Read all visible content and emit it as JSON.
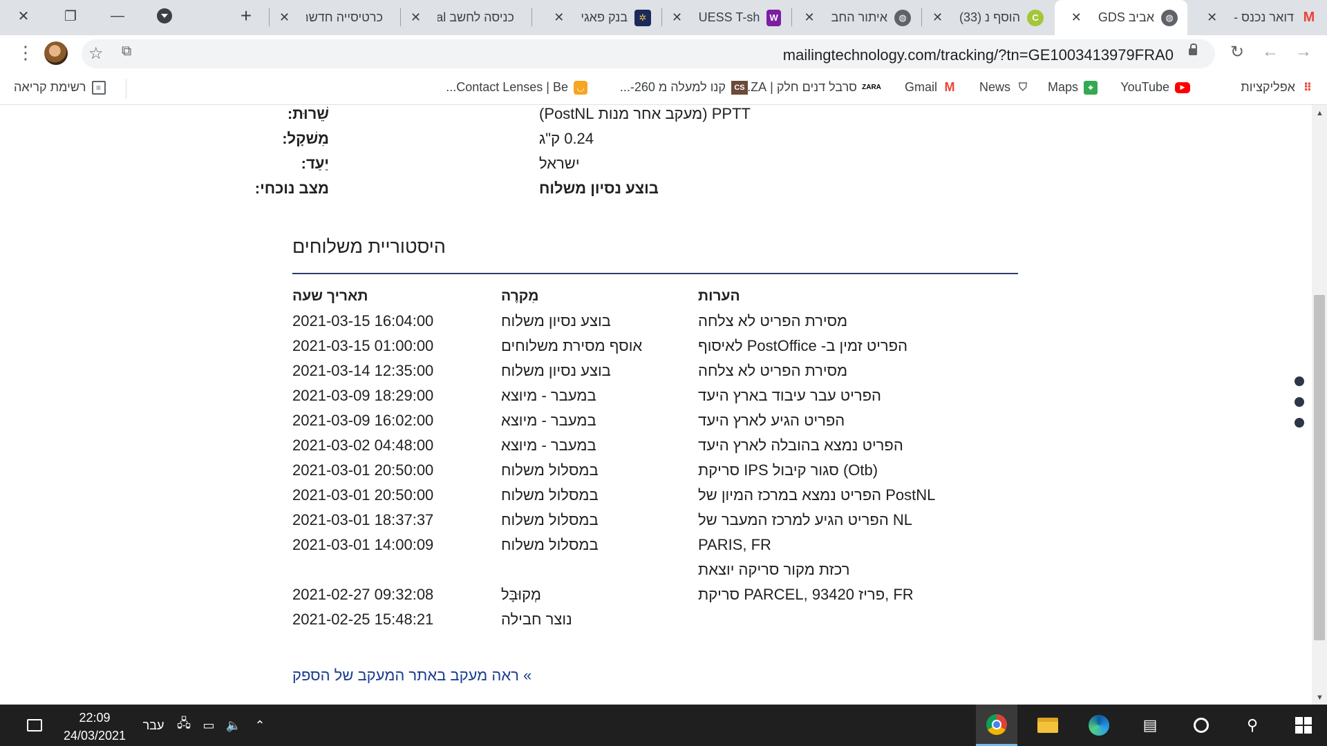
{
  "window_controls": {
    "close": "✕",
    "restore": "❐",
    "minimize": "—"
  },
  "tabs": [
    {
      "title": "דואר נכנס -",
      "icon": "gmail-icon",
      "active": false
    },
    {
      "title": "אביב GDS",
      "icon": "globe-icon",
      "active": true
    },
    {
      "title": "הוסף נ (33)",
      "icon": "green-app-icon",
      "active": false
    },
    {
      "title": "איתור החב",
      "icon": "globe-icon",
      "active": false
    },
    {
      "title": "GUESS T-sh",
      "icon": "w-purple-icon",
      "active": false
    },
    {
      "title": "בנק פאגי",
      "icon": "bank-icon",
      "active": false
    },
    {
      "title": "כניסה לחשב Cal",
      "icon": "cal-icon",
      "active": false
    },
    {
      "title": "כרטיסייה חדשה",
      "icon": "",
      "active": false
    }
  ],
  "new_tab_label": "+",
  "toolbar": {
    "url": "mailingtechnology.com/tracking/?tn=GE1003413979FRA0"
  },
  "bookmarks": [
    {
      "label": "אפליקציות",
      "icon": "apps-grid-icon"
    },
    {
      "label": "YouTube",
      "icon": "youtube-icon"
    },
    {
      "label": "Maps",
      "icon": "maps-icon"
    },
    {
      "label": "News",
      "icon": "news-icon"
    },
    {
      "label": "Gmail",
      "icon": "gmail-icon"
    },
    {
      "label": "סרבל דנים חלק | ZA...",
      "icon": "zara-icon"
    },
    {
      "label": "קנו למעלה מ 260-...",
      "icon": "cs-icon"
    },
    {
      "label": "Contact Lenses | Be...",
      "icon": "lens-icon"
    }
  ],
  "reading_list": "רשימת קריאה",
  "shipment_info": [
    {
      "label": "שֵׁרוּת:",
      "value": "PPTT (מעקב אחר מנות PostNL)",
      "bold_value": false
    },
    {
      "label": "מִשׁקָל:",
      "value": "0.24 ק\"ג",
      "bold_value": false
    },
    {
      "label": "יַעַד:",
      "value": "ישראל",
      "bold_value": false
    },
    {
      "label": "מצב נוכחי:",
      "value": "בוצע נסיון משלוח",
      "bold_value": true
    }
  ],
  "history": {
    "title": "היסטוריית משלוחים",
    "headers": {
      "datetime": "תאריך שעה",
      "event": "מִקרֶה",
      "notes": "הערות"
    },
    "rows": [
      {
        "datetime": "2021-03-15 16:04:00",
        "event": "בוצע נסיון משלוח",
        "notes": "מסירת הפריט לא צלחה"
      },
      {
        "datetime": "2021-03-15 01:00:00",
        "event": "אוסף מסירת משלוחים",
        "notes": "לאיסוף PostOffice -הפריט זמין ב"
      },
      {
        "datetime": "2021-03-14 12:35:00",
        "event": "בוצע נסיון משלוח",
        "notes": "מסירת הפריט לא צלחה"
      },
      {
        "datetime": "2021-03-09 18:29:00",
        "event": "במעבר - מיוצא",
        "notes": "הפריט עבר עיבוד בארץ היעד"
      },
      {
        "datetime": "2021-03-09 16:02:00",
        "event": "במעבר - מיוצא",
        "notes": "הפריט הגיע לארץ היעד"
      },
      {
        "datetime": "2021-03-02 04:48:00",
        "event": "במעבר - מיוצא",
        "notes": "הפריט נמצא בהובלה לארץ היעד"
      },
      {
        "datetime": "2021-03-01 20:50:00",
        "event": "במסלול משלוח",
        "notes": "סריקת IPS סגור קיבול (Otb)"
      },
      {
        "datetime": "2021-03-01 20:50:00",
        "event": "במסלול משלוח",
        "notes": "הפריט נמצא במרכז המיון של PostNL"
      },
      {
        "datetime": "2021-03-01 18:37:37",
        "event": "במסלול משלוח",
        "notes": "הפריט הגיע למרכז המעבר של NL"
      },
      {
        "datetime": "2021-03-01 14:00:09",
        "event": "במסלול משלוח",
        "notes": "PARIS, FR"
      },
      {
        "datetime": "",
        "event": "",
        "notes": "רכזת מקור סריקה יוצאת"
      },
      {
        "datetime": "2021-02-27 09:32:08",
        "event": "מְקוּבָּל",
        "notes": "סריקת PARCEL, 93420 פריז, FR"
      },
      {
        "datetime": "2021-02-25 15:48:21",
        "event": "נוצר חבילה",
        "notes": ""
      }
    ]
  },
  "more_link": "» ראה מעקב באתר המעקב של הספק",
  "taskbar": {
    "time": "22:09",
    "date": "24/03/2021",
    "language": "עבר"
  }
}
